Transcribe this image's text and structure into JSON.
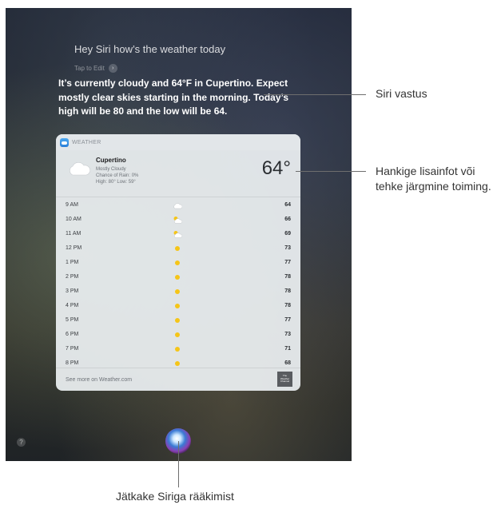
{
  "siri": {
    "query": "Hey Siri how’s the weather today",
    "tap_to_edit": "Tap to Edit",
    "response": "It’s currently cloudy and 64°F in Cupertino. Expect mostly clear skies starting in the morning. Today’s high will be 80 and the low will be 64."
  },
  "weather_card": {
    "app_name": "WEATHER",
    "location": "Cupertino",
    "condition": "Mostly Cloudy",
    "rain": "Chance of Rain: 0%",
    "high_low": "High: 80° Low: 59°",
    "current_temp": "64°",
    "hourly": [
      {
        "time": "9 AM",
        "temp": "64",
        "icon": "cloud-icon"
      },
      {
        "time": "10 AM",
        "temp": "66",
        "icon": "partly-cloudy-icon"
      },
      {
        "time": "11 AM",
        "temp": "69",
        "icon": "partly-cloudy-icon"
      },
      {
        "time": "12 PM",
        "temp": "73",
        "icon": "sun-icon"
      },
      {
        "time": "1 PM",
        "temp": "77",
        "icon": "sun-icon"
      },
      {
        "time": "2 PM",
        "temp": "78",
        "icon": "sun-icon"
      },
      {
        "time": "3 PM",
        "temp": "78",
        "icon": "sun-icon"
      },
      {
        "time": "4 PM",
        "temp": "78",
        "icon": "sun-icon"
      },
      {
        "time": "5 PM",
        "temp": "77",
        "icon": "sun-icon"
      },
      {
        "time": "6 PM",
        "temp": "73",
        "icon": "sun-icon"
      },
      {
        "time": "7 PM",
        "temp": "71",
        "icon": "sun-icon"
      },
      {
        "time": "8 PM",
        "temp": "68",
        "icon": "sun-icon"
      }
    ],
    "footer_link": "See more on Weather.com",
    "logo_text": "The Weather Channel"
  },
  "callouts": {
    "siri_response": "Siri vastus",
    "more_info": "Hankige lisainfot või tehke järgmine toiming.",
    "keep_talking": "Jätkake Siriga rääkimist"
  },
  "colors": {
    "sun": "#f5c518",
    "accent": "#3a7bd5"
  }
}
